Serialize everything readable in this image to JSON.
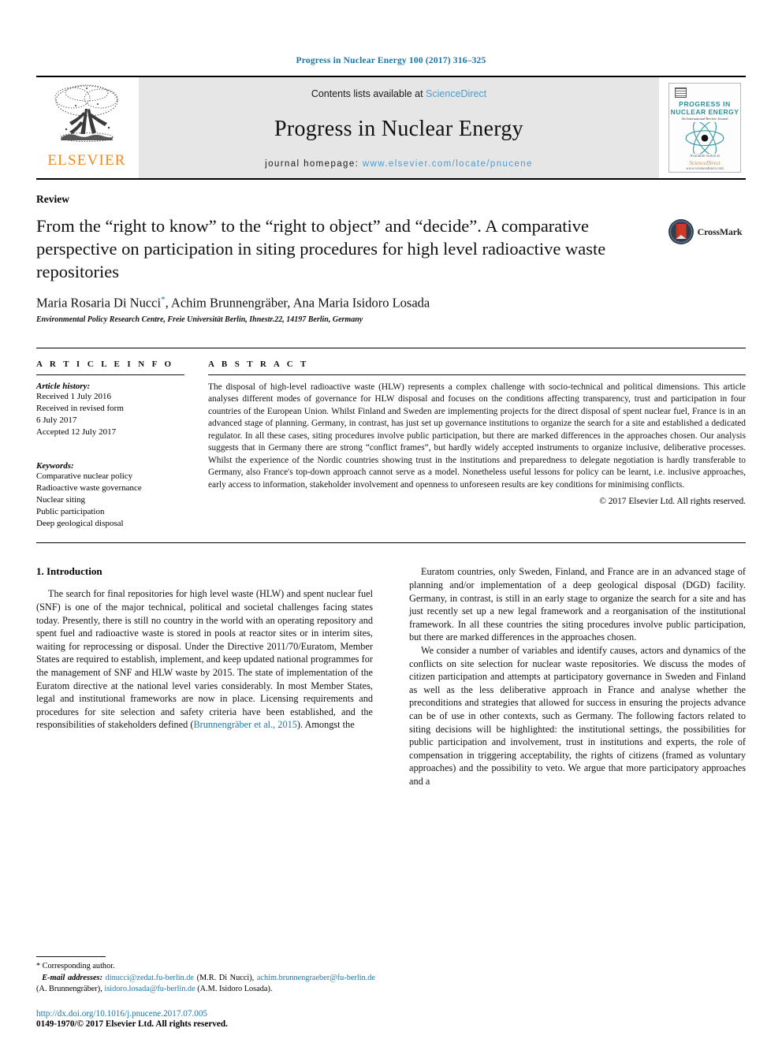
{
  "running_head": "Progress in Nuclear Energy 100 (2017) 316–325",
  "masthead": {
    "publisher_name": "ELSEVIER",
    "contents_prefix": "Contents lists available at ",
    "sciencedirect": "ScienceDirect",
    "journal_title": "Progress in Nuclear Energy",
    "homepage_label": "journal homepage: ",
    "homepage_url": "www.elsevier.com/locate/pnucene",
    "cover": {
      "line1": "PROGRESS IN",
      "line2": "NUCLEAR ENERGY",
      "line3": "An International Review Journal",
      "foot1": "Available online at",
      "foot2": "ScienceDirect",
      "foot3": "www.sciencedirect.com"
    }
  },
  "article": {
    "doctype": "Review",
    "title": "From the “right to know” to the “right to object” and “decide”. A comparative perspective on participation in siting procedures for high level radioactive waste repositories",
    "authors": "Maria Rosaria Di Nucci",
    "author_star": "*",
    "authors_rest": ", Achim Brunnengräber, Ana Maria Isidoro Losada",
    "affiliation": "Environmental Policy Research Centre, Freie Universität Berlin, Ihnestr.22, 14197 Berlin, Germany",
    "crossmark_label": "CrossMark"
  },
  "info": {
    "heading": "A R T I C L E  I N F O",
    "history_label": "Article history:",
    "history": [
      "Received 1 July 2016",
      "Received in revised form",
      "6 July 2017",
      "Accepted 12 July 2017"
    ],
    "keywords_label": "Keywords:",
    "keywords": [
      "Comparative nuclear policy",
      "Radioactive waste governance",
      "Nuclear siting",
      "Public participation",
      "Deep geological disposal"
    ]
  },
  "abstract": {
    "heading": "A B S T R A C T",
    "text": "The disposal of high-level radioactive waste (HLW) represents a complex challenge with socio-technical and political dimensions. This article analyses different modes of governance for HLW disposal and focuses on the conditions affecting transparency, trust and participation in four countries of the European Union. Whilst Finland and Sweden are implementing projects for the direct disposal of spent nuclear fuel, France is in an advanced stage of planning. Germany, in contrast, has just set up governance institutions to organize the search for a site and established a dedicated regulator. In all these cases, siting procedures involve public participation, but there are marked differences in the approaches chosen. Our analysis suggests that in Germany there are strong “conflict frames”, but hardly widely accepted instruments to organize inclusive, deliberative processes. Whilst the experience of the Nordic countries showing trust in the institutions and preparedness to delegate negotiation is hardly transferable to Germany, also France's top-down approach cannot serve as a model. Nonetheless useful lessons for policy can be learnt, i.e. inclusive approaches, early access to information, stakeholder involvement and openness to unforeseen results are key conditions for minimising conflicts.",
    "copyright": "© 2017 Elsevier Ltd. All rights reserved."
  },
  "body": {
    "section_title": "1. Introduction",
    "left_para_1": "The search for final repositories for high level waste (HLW) and spent nuclear fuel (SNF) is one of the major technical, political and societal challenges facing states today. Presently, there is still no country in the world with an operating repository and spent fuel and radioactive waste is stored in pools at reactor sites or in interim sites, waiting for reprocessing or disposal. Under the Directive 2011/70/Euratom, Member States are required to establish, implement, and keep updated national programmes for the management of SNF and HLW waste by 2015. The state of implementation of the Euratom directive at the national level varies considerably. In most Member States, legal and institutional frameworks are now in place. Licensing requirements and procedures for site selection and safety criteria have been established, and the responsibilities of stakeholders defined (",
    "left_citation": "Brunnengräber et al., 2015",
    "left_para_1_end": "). Amongst the",
    "right_para_1": "Euratom countries, only Sweden, Finland, and France are in an advanced stage of planning and/or implementation of a deep geological disposal (DGD) facility. Germany, in contrast, is still in an early stage to organize the search for a site and has just recently set up a new legal framework and a reorganisation of the institutional framework. In all these countries the siting procedures involve public participation, but there are marked differences in the approaches chosen.",
    "right_para_2": "We consider a number of variables and identify causes, actors and dynamics of the conflicts on site selection for nuclear waste repositories. We discuss the modes of citizen participation and attempts at participatory governance in Sweden and Finland as well as the less deliberative approach in France and analyse whether the preconditions and strategies that allowed for success in ensuring the projects advance can be of use in other contexts, such as Germany. The following factors related to siting decisions will be highlighted: the institutional settings, the possibilities for public participation and involvement, trust in institutions and experts, the role of compensation in triggering acceptability, the rights of citizens (framed as voluntary approaches) and the possibility to veto. We argue that more participatory approaches and a"
  },
  "footnote": {
    "corresponding": "Corresponding author.",
    "email_label": "E-mail addresses:",
    "email1": "dinucci@zedat.fu-berlin.de",
    "name1": "(M.R. Di Nucci),",
    "email2": "achim.brunnengraeber@fu-berlin.de",
    "name2": "(A. Brunnengräber),",
    "email3": "isidoro.losada@fu-berlin.de",
    "name3": "(A.M. Isidoro Losada)."
  },
  "doi": {
    "url": "http://dx.doi.org/10.1016/j.pnucene.2017.07.005",
    "issn_line": "0149-1970/© 2017 Elsevier Ltd. All rights reserved."
  },
  "colors": {
    "link": "#1b76a8",
    "sciencedirect": "#4a9ccf",
    "elsevier_orange": "#f08a1c",
    "cover_teal": "#2d8f9e",
    "band_gray": "#e6e6e6"
  }
}
